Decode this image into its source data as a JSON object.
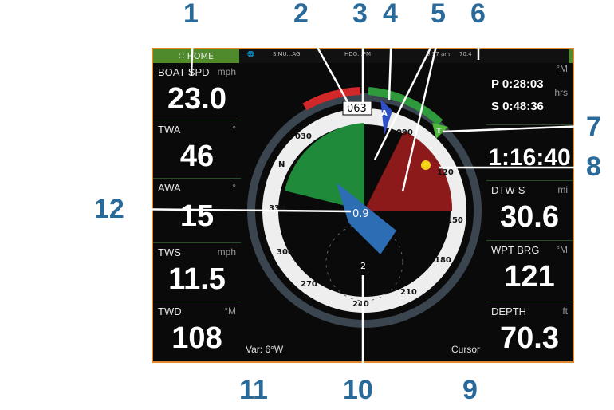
{
  "topbar": {
    "home_label": "HOME",
    "items": [
      "SIMU...AG",
      "HDG...PM",
      "9:57 am",
      "70.4"
    ]
  },
  "left_panels": [
    {
      "label": "BOAT SPD",
      "unit": "mph",
      "value": "23.0"
    },
    {
      "label": "TWA",
      "unit": "°",
      "value": "46"
    },
    {
      "label": "AWA",
      "unit": "°",
      "value": "15"
    },
    {
      "label": "TWS",
      "unit": "mph",
      "value": "11.5"
    },
    {
      "label": "TWD",
      "unit": "°M",
      "value": "108"
    }
  ],
  "right_panels": {
    "timers": {
      "unit_top": "°M",
      "p": "P 0:28:03",
      "s": "S 0:48:36",
      "unit": "hrs"
    },
    "ttg": {
      "value": "1:16:40"
    },
    "dtw": {
      "label": "DTW-S",
      "unit": "mi",
      "value": "30.6"
    },
    "wpt": {
      "label": "WPT BRG",
      "unit": "°M",
      "value": "121"
    },
    "depth": {
      "label": "DEPTH",
      "unit": "ft",
      "value": "70.3"
    }
  },
  "gauge": {
    "heading": "063",
    "scale_labels": [
      "030",
      "N",
      "330",
      "300",
      "270",
      "240",
      "210",
      "180",
      "150",
      "120",
      "090"
    ],
    "wind_marker": "A",
    "true_marker": "T",
    "boat_speed_reading": "0.9",
    "inner_scale": "2"
  },
  "bottom": {
    "var": "Var: 6°W",
    "cursor": "Cursor"
  },
  "callouts": [
    "1",
    "2",
    "3",
    "4",
    "5",
    "6",
    "7",
    "8",
    "9",
    "10",
    "11",
    "12"
  ],
  "colors": {
    "frame": "#e3892b",
    "callout": "#2a6a9a",
    "port": "#d2282a",
    "starboard": "#2f9a3c"
  }
}
